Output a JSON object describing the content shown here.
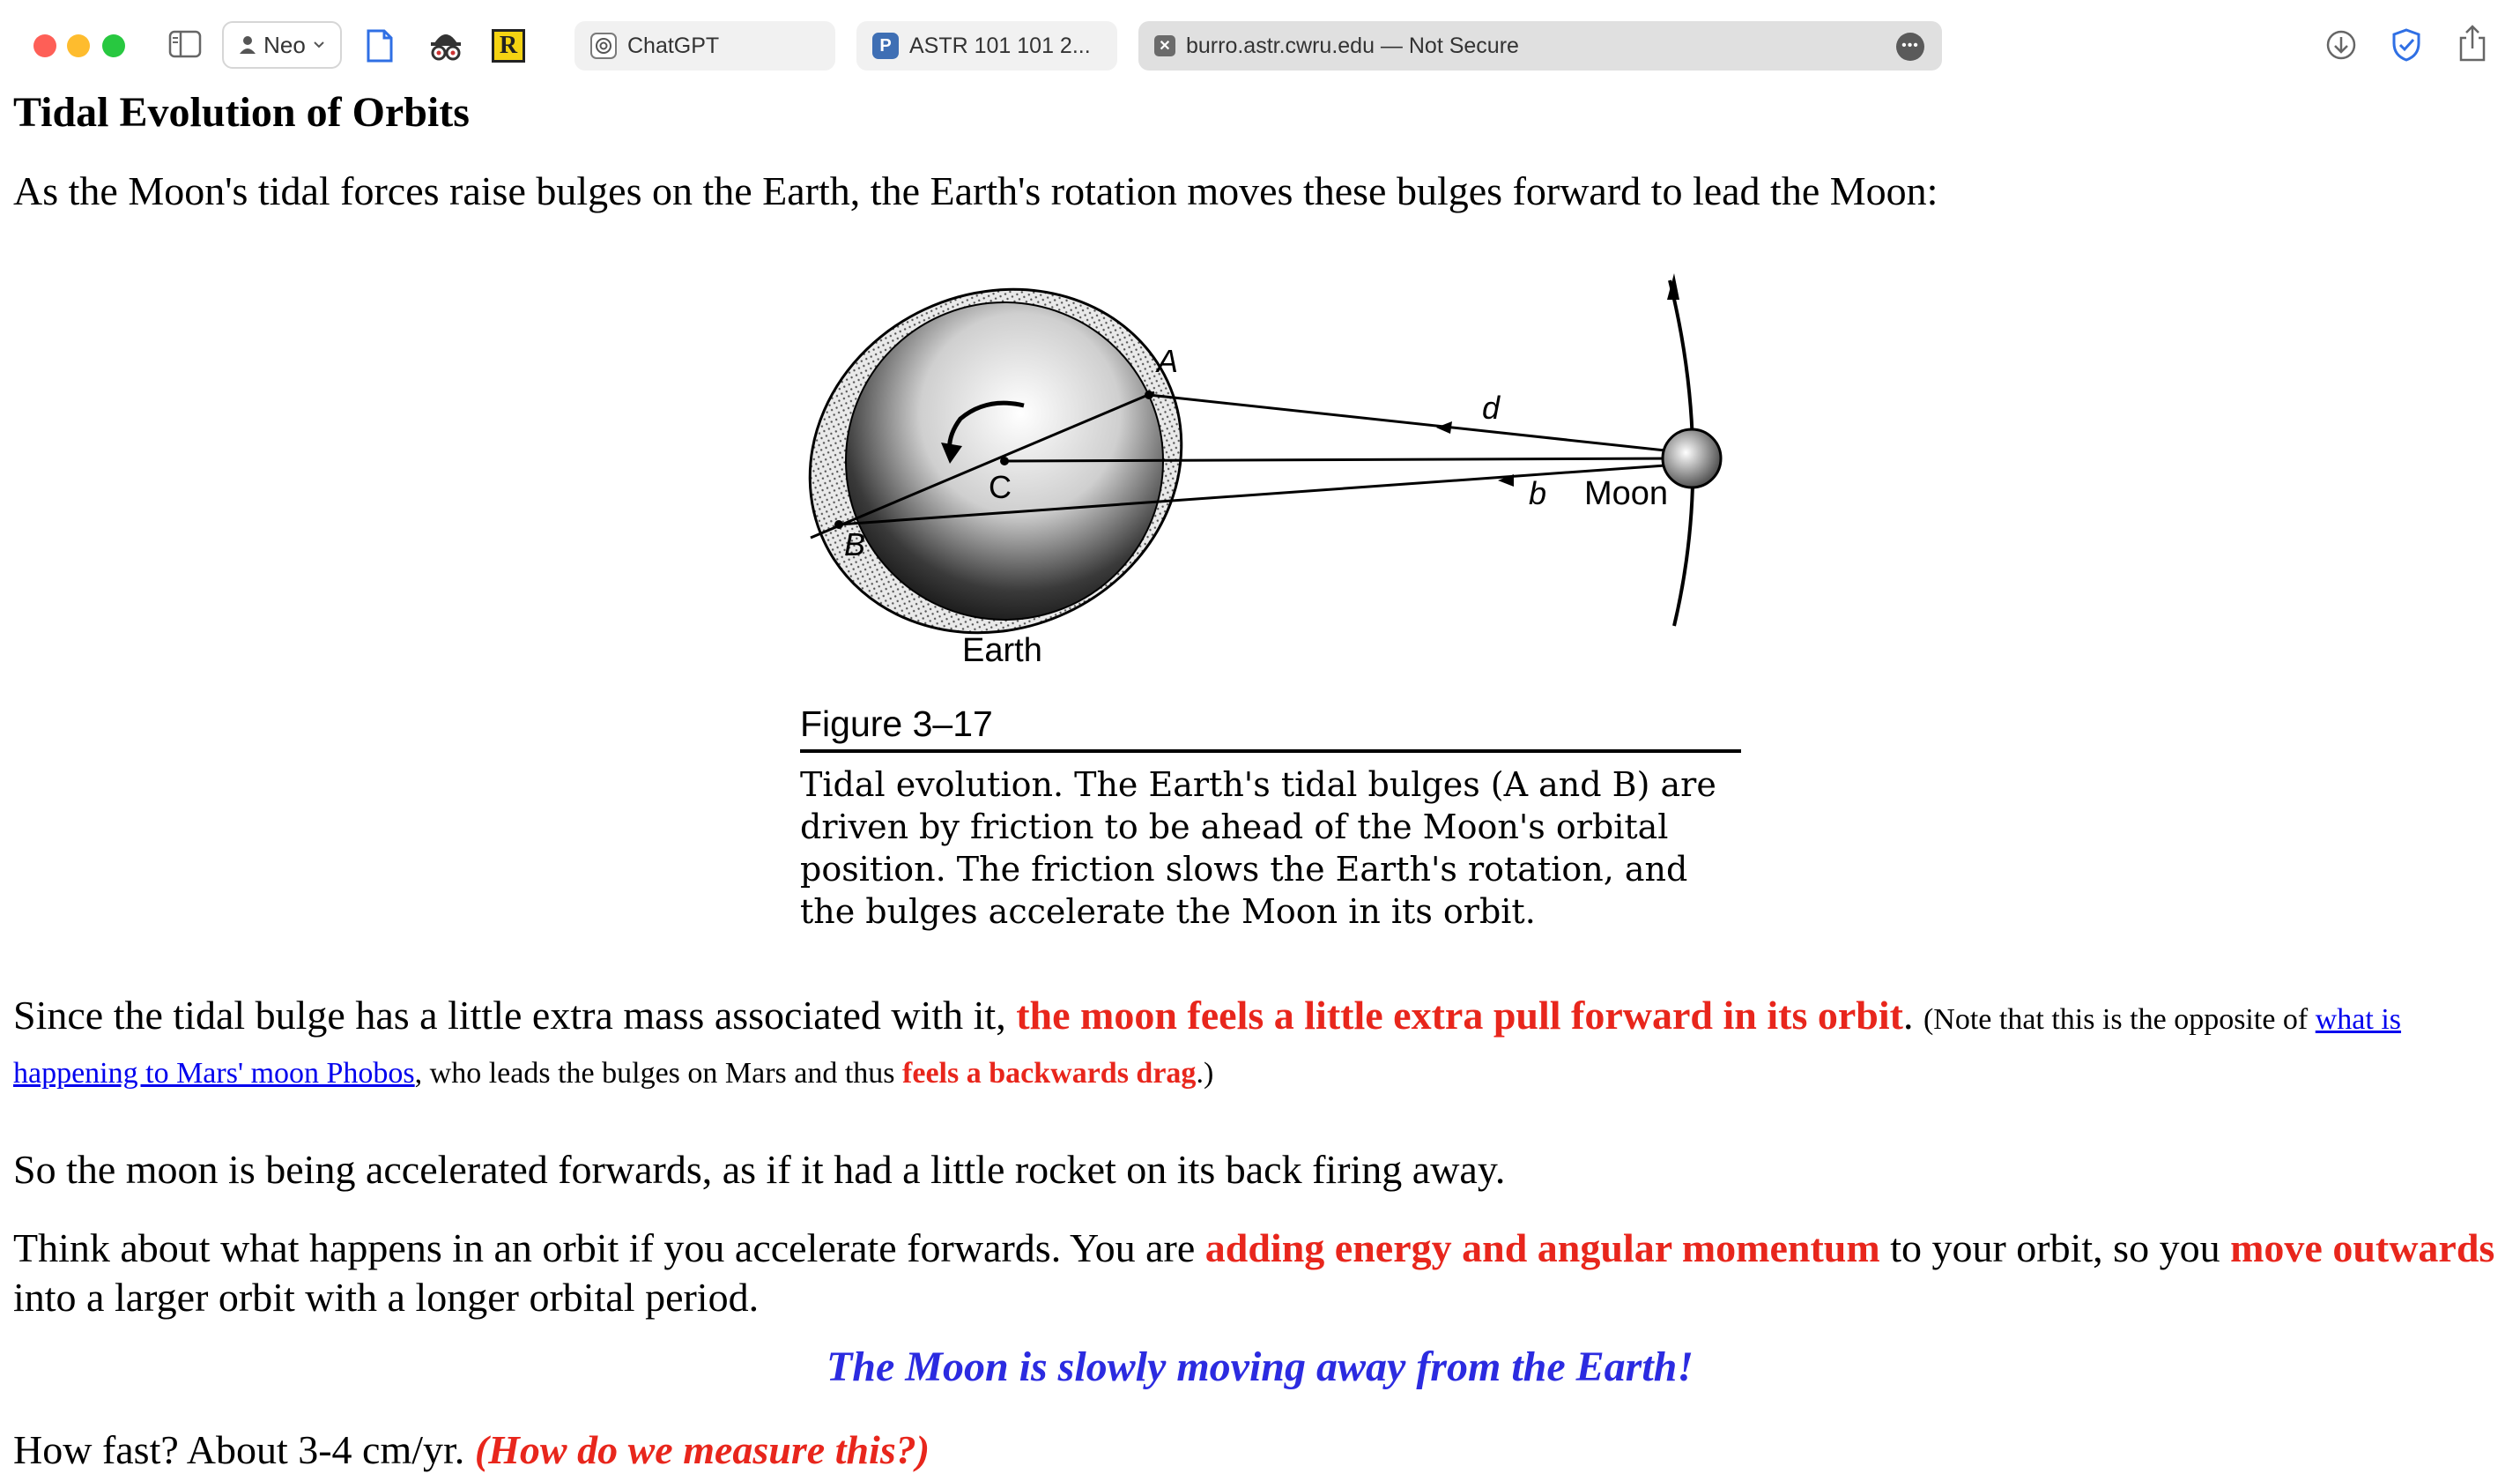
{
  "browser": {
    "profile": "Neo",
    "tabs": [
      {
        "label": "ChatGPT",
        "active": false
      },
      {
        "label": "ASTR 101 101 2...",
        "active": false
      },
      {
        "label": "burro.astr.cwru.edu — Not Secure",
        "active": true
      }
    ],
    "toolbar_icons": [
      "sidebar-toggle-icon",
      "document-icon",
      "spy-icon",
      "r-badge-icon",
      "download-icon",
      "shield-check-icon",
      "share-icon"
    ]
  },
  "page": {
    "title": "Tidal Evolution of Orbits",
    "intro": "As the Moon's tidal forces raise  bulges on the Earth, the Earth's rotation moves these bulges forward to lead the Moon:",
    "figure": {
      "labels": {
        "a": "A",
        "b_point": "B",
        "c": "C",
        "d": "d",
        "b": "b",
        "moon": "Moon",
        "earth": "Earth"
      },
      "heading": "Figure 3–17",
      "caption": "Tidal evolution. The Earth's tidal bulges (A and B) are driven by friction to be ahead of the Moon's orbital position. The friction slows the Earth's rotation, and the bulges accelerate the Moon in its orbit."
    },
    "para1": {
      "text1": "Since the tidal bulge has a little extra mass associated with it, ",
      "highlight1": "the moon feels a little extra pull forward in its orbit",
      "text2": ". ",
      "note_start": "(Note that this is the opposite of ",
      "link": "what is happening to Mars' moon Phobos",
      "note_mid": ", who leads the bulges on Mars and thus ",
      "highlight2": "feels a backwards drag",
      "note_end": ".)"
    },
    "para2": "So the moon is being accelerated forwards, as if it had a little rocket on its back firing away.",
    "para3": {
      "text1": "Think about what happens in an orbit if you accelerate forwards. You are ",
      "highlight1": "adding energy and angular momentum",
      "text2": " to your orbit, so you ",
      "highlight2": "move outwards",
      "text3": " into a larger orbit with a longer orbital period."
    },
    "tagline": "The Moon is slowly moving away from the Earth!",
    "para4": {
      "text": "How fast? About 3-4 cm/yr. ",
      "question": "(How do we measure this?)"
    }
  },
  "colors": {
    "highlight": "#e8261c",
    "link": "#0000ee",
    "tagline": "#2b2be0"
  }
}
